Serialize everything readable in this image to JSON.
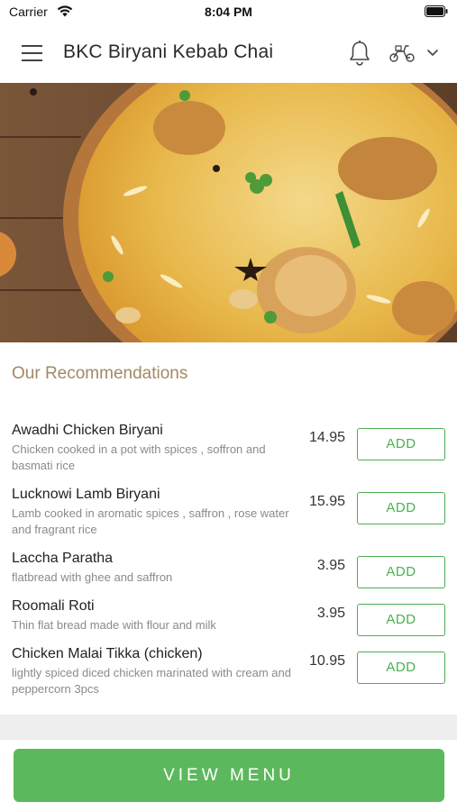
{
  "status_bar": {
    "carrier": "Carrier",
    "time": "8:04 PM"
  },
  "header": {
    "title": "BKC Biryani Kebab Chai",
    "icons": [
      "menu-icon",
      "bell-icon",
      "scooter-icon",
      "chevron-down-icon"
    ]
  },
  "section": {
    "title": "Our Recommendations"
  },
  "items": [
    {
      "name": "Awadhi Chicken Biryani",
      "description": "Chicken cooked in a pot with spices , soffron and basmati rice",
      "price": "14.95",
      "add_label": "ADD"
    },
    {
      "name": "Lucknowi Lamb Biryani",
      "description": "Lamb cooked in aromatic spices , saffron , rose water and fragrant rice",
      "price": "15.95",
      "add_label": "ADD"
    },
    {
      "name": "Laccha Paratha",
      "description": "flatbread with ghee and saffron",
      "price": "3.95",
      "add_label": "ADD"
    },
    {
      "name": "Roomali Roti",
      "description": "Thin flat bread made with flour and milk",
      "price": "3.95",
      "add_label": "ADD"
    },
    {
      "name": "Chicken Malai Tikka (chicken)",
      "description": "lightly spiced diced chicken marinated with cream and peppercorn 3pcs",
      "price": "10.95",
      "add_label": "ADD"
    }
  ],
  "footer": {
    "view_menu_label": "VIEW MENU"
  },
  "colors": {
    "accent_green": "#4caf50",
    "button_green": "#5cb85c",
    "section_title": "#a08a66"
  }
}
